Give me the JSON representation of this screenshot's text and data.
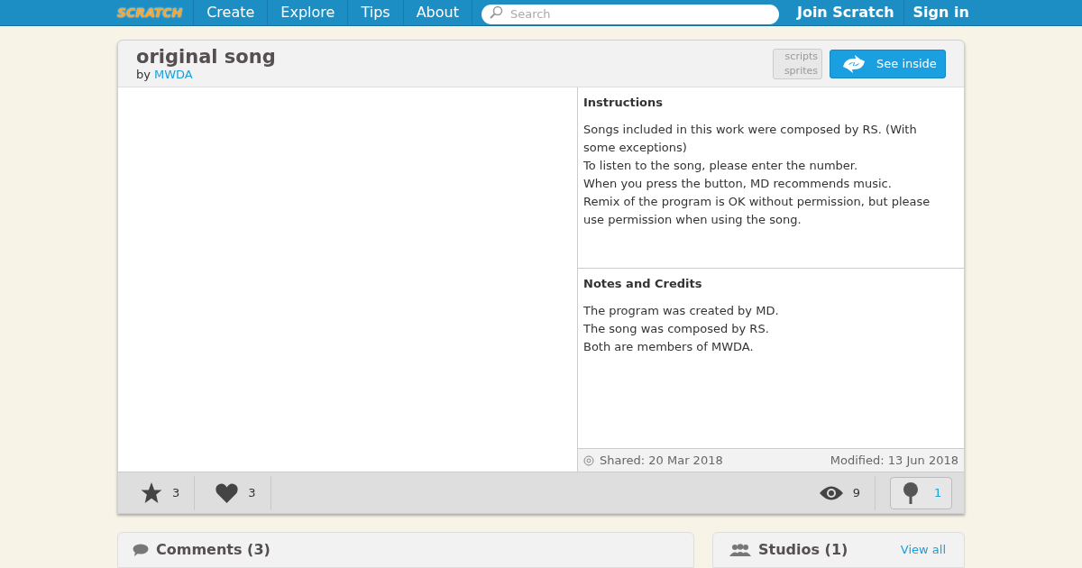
{
  "nav": {
    "logo": "SCRATCH",
    "links": [
      "Create",
      "Explore",
      "Tips",
      "About"
    ],
    "search": {
      "placeholder": "Search"
    },
    "account": [
      "Join Scratch",
      "Sign in"
    ]
  },
  "project": {
    "title": "original song",
    "by": "by",
    "author": "MWDA",
    "toggle": [
      "scripts",
      "sprites"
    ],
    "see_inside": "See inside"
  },
  "instructions": {
    "heading": "Instructions",
    "lines": [
      "Songs included in this work were composed by RS. (With some exceptions)",
      "To listen to the song, please enter the number.",
      "When you press the button, MD recommends music.",
      "Remix of the program is OK without permission, but please use permission when using the song."
    ]
  },
  "notes": {
    "heading": "Notes and Credits",
    "lines": [
      "The program was created by MD.",
      "The song was composed by RS.",
      "Both are members of MWDA."
    ]
  },
  "dates": {
    "shared": "Shared: 20 Mar 2018",
    "modified": "Modified: 13 Jun 2018"
  },
  "stats": {
    "favorites": "3",
    "loves": "3",
    "views": "9",
    "remixes": "1"
  },
  "comments": {
    "title": "Comments (3)"
  },
  "studios": {
    "title": "Studios (1)",
    "view_all": "View all"
  }
}
